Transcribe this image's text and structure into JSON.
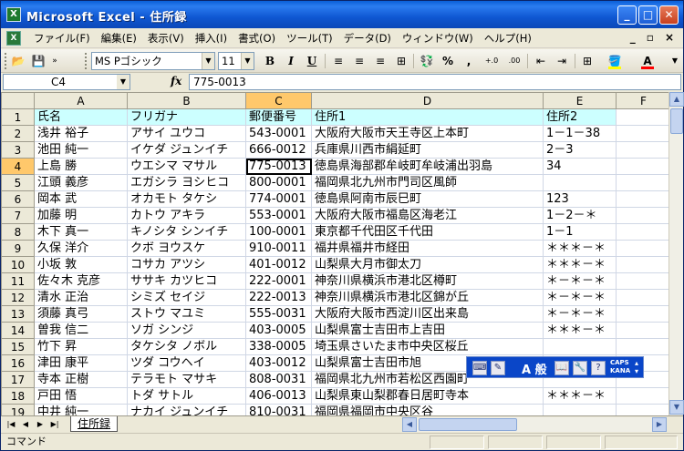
{
  "window": {
    "app_icon": "excel-icon",
    "title": "Microsoft Excel - 住所録",
    "minimize": "_",
    "maximize": "□",
    "close": "✕"
  },
  "menu": {
    "items": [
      "ファイル(F)",
      "編集(E)",
      "表示(V)",
      "挿入(I)",
      "書式(O)",
      "ツール(T)",
      "データ(D)",
      "ウィンドウ(W)",
      "ヘルプ(H)"
    ],
    "right": [
      "_",
      "▫",
      "×"
    ]
  },
  "toolbar": {
    "font_name": "MS Pゴシック",
    "font_size": "11",
    "bold": "B",
    "italic": "I",
    "underline": "U",
    "percent": "%",
    "comma": ",",
    "increase_decimal": "+.0",
    "decrease_decimal": ".00",
    "fill_color": "#ffff00",
    "font_color": "#ff0000"
  },
  "formula_bar": {
    "cell_ref": "C4",
    "fx": "fx",
    "value": "775-0013"
  },
  "sheet": {
    "columns": [
      "A",
      "B",
      "C",
      "D",
      "E",
      "F"
    ],
    "selected_column": "C",
    "selected_row": 4,
    "rows": [
      [
        "氏名",
        "フリガナ",
        "郵便番号",
        "住所1",
        "住所2",
        ""
      ],
      [
        "浅井 裕子",
        "アサイ ユウコ",
        "543-0001",
        "大阪府大阪市天王寺区上本町",
        "1－1－38",
        ""
      ],
      [
        "池田 純一",
        "イケダ ジュンイチ",
        "666-0012",
        "兵庫県川西市絹延町",
        "2－3",
        ""
      ],
      [
        "上島 勝",
        "ウエシマ マサル",
        "775-0013",
        "徳島県海部郡牟岐町牟岐浦出羽島",
        "34",
        ""
      ],
      [
        "江頭 義彦",
        "エガシラ ヨシヒコ",
        "800-0001",
        "福岡県北九州市門司区風師",
        "",
        ""
      ],
      [
        "岡本 武",
        "オカモト タケシ",
        "774-0001",
        "徳島県阿南市辰巳町",
        "123",
        ""
      ],
      [
        "加藤 明",
        "カトウ アキラ",
        "553-0001",
        "大阪府大阪市福島区海老江",
        "1－2－＊",
        ""
      ],
      [
        "木下 真一",
        "キノシタ シンイチ",
        "100-0001",
        "東京都千代田区千代田",
        "1－1",
        ""
      ],
      [
        "久保 洋介",
        "クボ ヨウスケ",
        "910-0011",
        "福井県福井市経田",
        "＊＊＊－＊",
        ""
      ],
      [
        "小坂 敦",
        "コサカ アツシ",
        "401-0012",
        "山梨県大月市御太刀",
        "＊＊＊－＊",
        ""
      ],
      [
        "佐々木 克彦",
        "ササキ カツヒコ",
        "222-0001",
        "神奈川県横浜市港北区樽町",
        "＊－＊－＊",
        ""
      ],
      [
        "清水 正治",
        "シミズ セイジ",
        "222-0013",
        "神奈川県横浜市港北区錦が丘",
        "＊－＊－＊",
        ""
      ],
      [
        "須藤 真弓",
        "ストウ マユミ",
        "555-0031",
        "大阪府大阪市西淀川区出来島",
        "＊－＊－＊",
        ""
      ],
      [
        "曽我 信二",
        "ソガ シンジ",
        "403-0005",
        "山梨県富士吉田市上吉田",
        "＊＊＊－＊",
        ""
      ],
      [
        "竹下 昇",
        "タケシタ ノボル",
        "338-0005",
        "埼玉県さいたま市中央区桜丘",
        "",
        ""
      ],
      [
        "津田 康平",
        "ツダ コウヘイ",
        "403-0012",
        "山梨県富士吉田市旭",
        "",
        ""
      ],
      [
        "寺本 正樹",
        "テラモト マサキ",
        "808-0031",
        "福岡県北九州市若松区西園町",
        "",
        ""
      ],
      [
        "戸田 悟",
        "トダ サトル",
        "406-0013",
        "山梨県東山梨郡春日居町寺本",
        "＊＊＊－＊",
        ""
      ],
      [
        "中井 純一",
        "ナカイ ジュンイチ",
        "810-0031",
        "福岡県福岡市中央区谷",
        "",
        ""
      ]
    ]
  },
  "ime_bar": {
    "mode": "A 般",
    "caps": "CAPS",
    "kana": "KANA"
  },
  "tabs": {
    "sheet_name": "住所録"
  },
  "status": {
    "text": "コマンド"
  }
}
